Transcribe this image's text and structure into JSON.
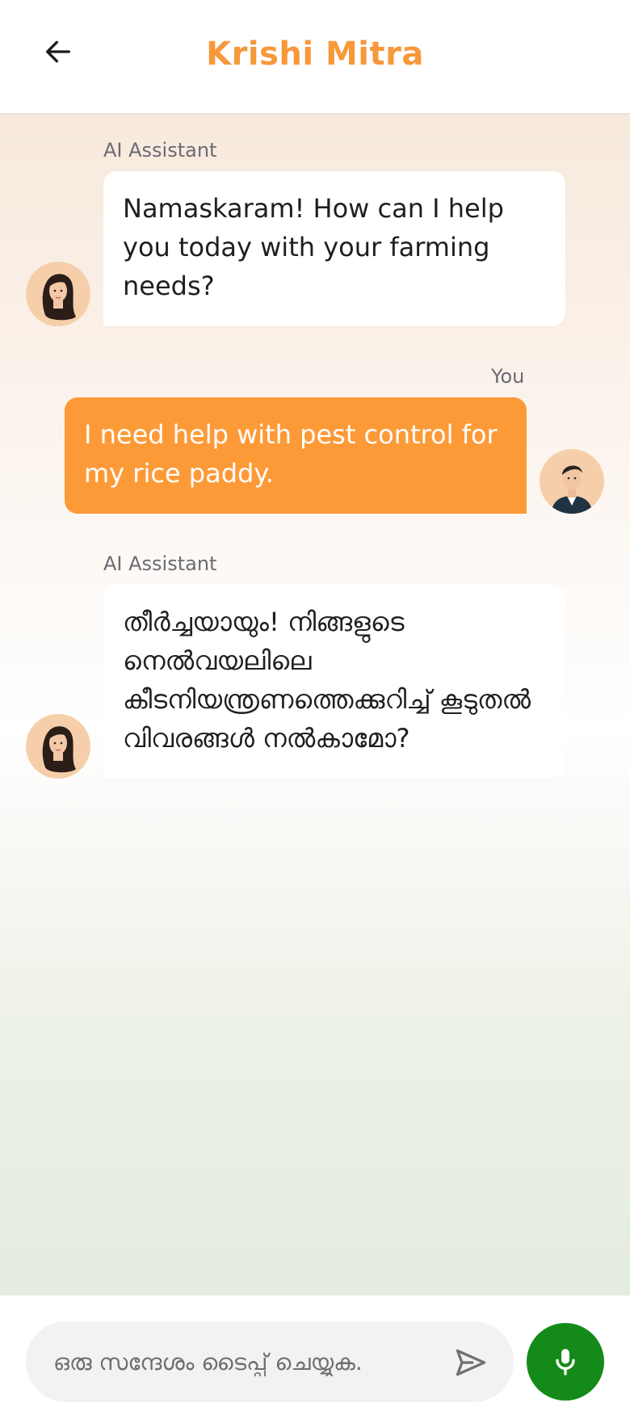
{
  "header": {
    "title": "Krishi Mitra",
    "back_icon": "arrow-left-icon"
  },
  "messages": [
    {
      "role": "assistant",
      "sender": "AI Assistant",
      "text": "Namaskaram! How can I help you today with your farming needs?"
    },
    {
      "role": "user",
      "sender": "You",
      "text": "I need help with pest control for my rice paddy."
    },
    {
      "role": "assistant",
      "sender": "AI Assistant",
      "text": "തീർച്ചയായും! നിങ്ങളുടെ നെൽവയലിലെ കീടനിയന്ത്രണത്തെക്കുറിച്ച് കൂടുതൽ വിവരങ്ങൾ നൽകാമോ?"
    }
  ],
  "composer": {
    "placeholder": "ഒരു സന്ദേശം ടൈപ്പ് ചെയ്യുക.",
    "value": "",
    "send_icon": "send-icon",
    "mic_icon": "microphone-icon"
  },
  "colors": {
    "brand": "#f7983a",
    "user_bubble": "#fd9a38",
    "mic_button": "#148a1a"
  }
}
